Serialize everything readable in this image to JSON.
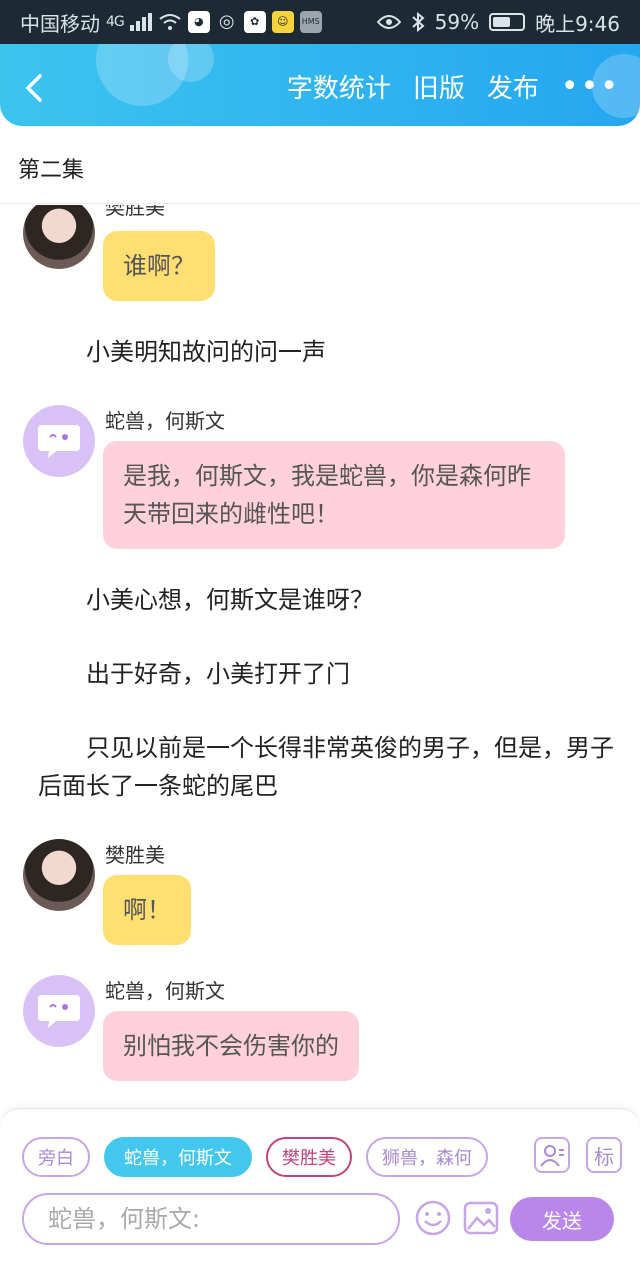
{
  "status_bar": {
    "carrier": "中国移动",
    "network": "4G",
    "app_icons": [
      "qq-browser-icon",
      "wechat-icon",
      "baidu-icon",
      "app-icon",
      "hms-icon"
    ],
    "hms_label": "HMS",
    "battery": "59%",
    "battery_level": 0.59,
    "time": "晚上9:46"
  },
  "header": {
    "back_icon": "chevron-left-icon",
    "buttons": [
      "字数统计",
      "旧版",
      "发布"
    ],
    "more_icon": "more-dots-icon",
    "accent": "#3cc4ef"
  },
  "episode_title": "第二集",
  "messages": [
    {
      "type": "dialog",
      "speaker": "樊胜美",
      "avatar": "girl-avatar",
      "text": "谁啊？",
      "bubble": "#ffdf72"
    },
    {
      "type": "narration",
      "text": "小美明知故问的问一声"
    },
    {
      "type": "dialog",
      "speaker": "蛇兽，何斯文",
      "avatar": "speech-bubble-avatar",
      "text": "是我，何斯文，我是蛇兽，你是森何昨天带回来的雌性吧！",
      "bubble": "#ffd1dc"
    },
    {
      "type": "narration",
      "text": "小美心想，何斯文是谁呀？"
    },
    {
      "type": "narration",
      "text": "出于好奇，小美打开了门"
    },
    {
      "type": "narration",
      "text": "只见以前是一个长得非常英俊的男子，但是，男子后面长了一条蛇的尾巴"
    },
    {
      "type": "dialog",
      "speaker": "樊胜美",
      "avatar": "girl-avatar",
      "text": "啊！",
      "bubble": "#ffdf72"
    },
    {
      "type": "dialog",
      "speaker": "蛇兽，何斯文",
      "avatar": "speech-bubble-avatar",
      "text": "别怕我不会伤害你的",
      "bubble": "#ffd1dc"
    }
  ],
  "composer": {
    "roles": [
      "旁白",
      "蛇兽，何斯文",
      "樊胜美",
      "狮兽，森何"
    ],
    "active_role": "蛇兽，何斯文",
    "person_icon": "person-card-icon",
    "mark_label": "标",
    "placeholder": "蛇兽，何斯文:",
    "emoji_icon": "smiley-icon",
    "image_icon": "image-icon",
    "send_label": "发送",
    "send_color": "#b987ea"
  }
}
